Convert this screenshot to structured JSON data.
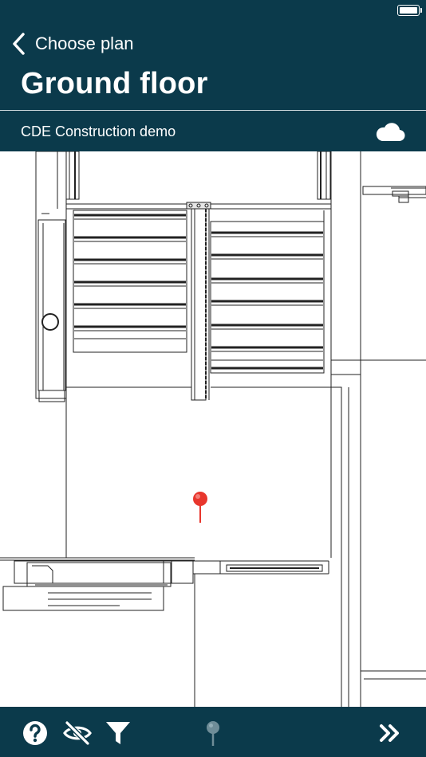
{
  "header": {
    "back_label": "Choose plan",
    "title": "Ground floor"
  },
  "subheader": {
    "project_name": "CDE Construction demo",
    "sync_icon": "cloud-icon"
  },
  "plan": {
    "pin_icon": "location-pin-icon",
    "pin_color": "#e8362d"
  },
  "toolbar": {
    "help_icon": "question-circle-icon",
    "visibility_icon": "eye-slash-icon",
    "filter_icon": "filter-funnel-icon",
    "pin_icon": "location-pin-icon",
    "more_icon": "double-chevron-right-icon"
  },
  "colors": {
    "header_bg": "#0b3a4b",
    "text": "#ffffff"
  }
}
